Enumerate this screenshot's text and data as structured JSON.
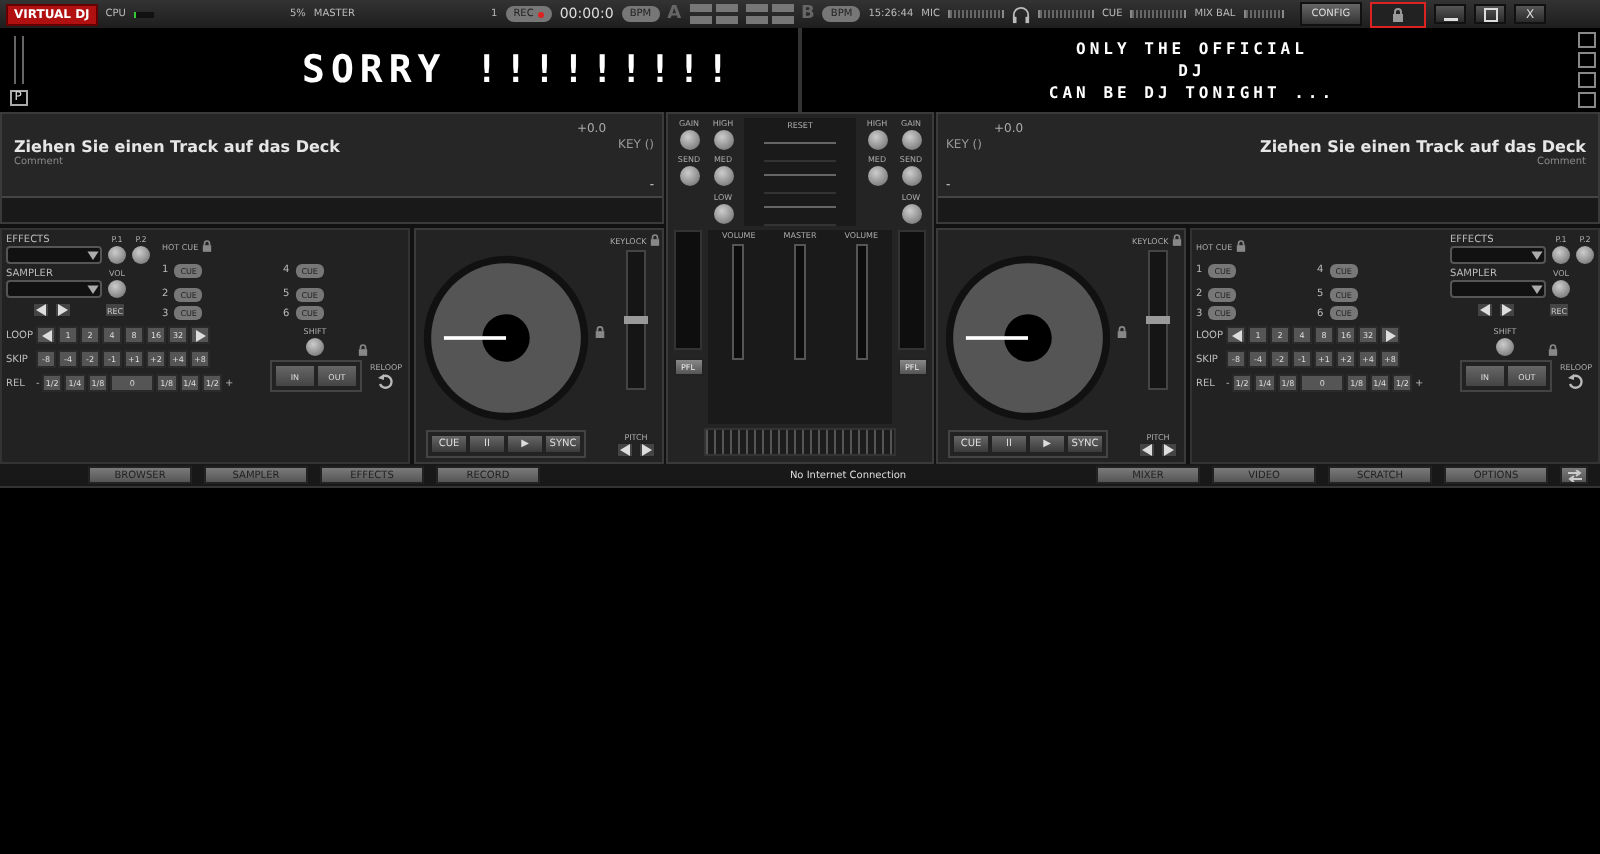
{
  "top_bar": {
    "logo": "VIRTUAL DJ",
    "cpu_label": "CPU",
    "cpu_meter": {
      "level": 0.05
    },
    "cpu_percent": "5%",
    "master_label": "MASTER",
    "master_channel": "1",
    "rec_button": "REC",
    "time_counter": "00:00:0",
    "bpm_a": "BPM",
    "deck_a": "A",
    "deck_b": "B",
    "bpm_b": "BPM",
    "clock": "15:26:44",
    "mic_label": "MIC",
    "cue_label": "CUE",
    "mix_bal_label": "MIX BAL",
    "config_button": "CONFIG",
    "close_button": "X"
  },
  "marquee": {
    "left_text": "SORRY !!!!!!!!!",
    "left_button": "P",
    "right_lines": [
      "ONLY THE OFFICIAL",
      "DJ",
      "CAN BE DJ TONIGHT ..."
    ]
  },
  "decks": [
    {
      "kind": "left",
      "pitch_slider": {
        "level": 0.5
      },
      "title": "Ziehen Sie einen Track auf das Deck",
      "comment": "Comment",
      "pitch_value": "+0.0",
      "key": "KEY ()",
      "key_value": "-",
      "effects_label": "EFFECTS",
      "effect_knobs": [
        "P.1",
        "P.2"
      ],
      "sampler_label": "SAMPLER",
      "vol_label": "VOL",
      "rec_button": "REC",
      "hot_cues": [
        {
          "number": "1",
          "label": "CUE"
        },
        {
          "number": "2",
          "label": "CUE"
        },
        {
          "number": "3",
          "label": "CUE"
        },
        {
          "number": "4",
          "label": "CUE"
        },
        {
          "number": "5",
          "label": "CUE"
        },
        {
          "number": "6",
          "label": "CUE"
        }
      ],
      "hot_cue_label": "HOT CUE",
      "loop_label": "LOOP",
      "loop_sizes": [
        "1",
        "2",
        "4",
        "8",
        "16",
        "32"
      ],
      "skip_label": "SKIP",
      "skip_values": [
        "-8",
        "-4",
        "-2",
        "-1",
        "+1",
        "+2",
        "+4",
        "+8"
      ],
      "rel_label": "REL",
      "rel_minus": "-",
      "rel_values": [
        "1/2",
        "1/4",
        "1/8",
        "0",
        "1/8",
        "1/4",
        "1/2"
      ],
      "rel_plus": "+",
      "shift_label": "SHIFT",
      "in_button": "IN",
      "out_button": "OUT",
      "reloop_label": "RELOOP",
      "keylock_label": "KEYLOCK",
      "pitch_label": "PITCH",
      "transport": [
        "CUE",
        "II",
        "▶",
        "SYNC"
      ]
    },
    {
      "kind": "right",
      "pitch_slider": {
        "level": 0.5
      },
      "title": "Ziehen Sie einen Track auf das Deck",
      "comment": "Comment",
      "pitch_value": "+0.0",
      "key": "KEY ()",
      "key_value": "-",
      "effects_label": "EFFECTS",
      "effect_knobs": [
        "P.1",
        "P.2"
      ],
      "sampler_label": "SAMPLER",
      "vol_label": "VOL",
      "rec_button": "REC",
      "hot_cues": [
        {
          "number": "1",
          "label": "CUE"
        },
        {
          "number": "2",
          "label": "CUE"
        },
        {
          "number": "3",
          "label": "CUE"
        },
        {
          "number": "4",
          "label": "CUE"
        },
        {
          "number": "5",
          "label": "CUE"
        },
        {
          "number": "6",
          "label": "CUE"
        }
      ],
      "hot_cue_label": "HOT CUE",
      "loop_label": "LOOP",
      "loop_sizes": [
        "1",
        "2",
        "4",
        "8",
        "16",
        "32"
      ],
      "skip_label": "SKIP",
      "skip_values": [
        "-8",
        "-4",
        "-2",
        "-1",
        "+1",
        "+2",
        "+4",
        "+8"
      ],
      "rel_label": "REL",
      "rel_minus": "-",
      "rel_values": [
        "1/2",
        "1/4",
        "1/8",
        "0",
        "1/8",
        "1/4",
        "1/2"
      ],
      "rel_plus": "+",
      "shift_label": "SHIFT",
      "in_button": "IN",
      "out_button": "OUT",
      "reloop_label": "RELOOP",
      "keylock_label": "KEYLOCK",
      "pitch_label": "PITCH",
      "transport": [
        "CUE",
        "II",
        "▶",
        "SYNC"
      ]
    }
  ],
  "mixer": {
    "reset_label": "RESET",
    "left_knobs": [
      "GAIN",
      "HIGH",
      "SEND",
      "MED",
      "LOW"
    ],
    "right_knobs": [
      "HIGH",
      "GAIN",
      "MED",
      "SEND",
      "LOW"
    ],
    "faders": [
      "VOLUME",
      "MASTER",
      "VOLUME"
    ],
    "pfl_buttons": [
      "PFL",
      "PFL"
    ]
  },
  "bottom_tabs": {
    "left": [
      {
        "label": "BROWSER",
        "selected": false
      },
      {
        "label": "SAMPLER",
        "selected": false
      },
      {
        "label": "EFFECTS",
        "selected": false
      },
      {
        "label": "RECORD",
        "selected": false
      }
    ],
    "status": "No Internet Connection",
    "right": [
      {
        "label": "MIXER",
        "selected": false
      },
      {
        "label": "VIDEO",
        "selected": false
      },
      {
        "label": "SCRATCH",
        "selected": false
      },
      {
        "label": "OPTIONS",
        "selected": false
      }
    ]
  }
}
